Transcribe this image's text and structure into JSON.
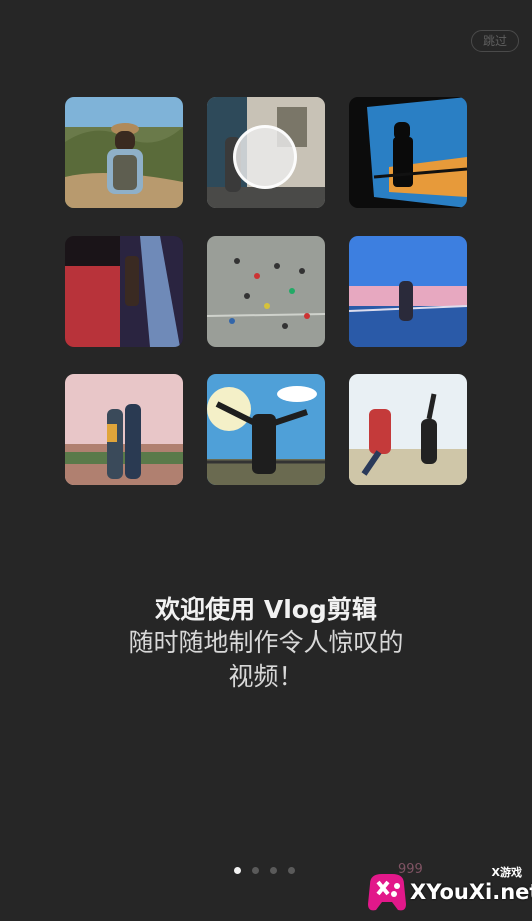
{
  "skip_label": "跳过",
  "welcome": {
    "title": "欢迎使用 Vlog剪辑",
    "subtitle_line1": "随时随地制作令人惊叹的",
    "subtitle_line2": "视频！"
  },
  "pager": {
    "total": 4,
    "active_index": 0
  },
  "watermark": {
    "top_text": "X游戏",
    "main_text": "XYouXi.net",
    "faint_text": "999"
  },
  "colors": {
    "background": "#262626",
    "text_primary": "#f2f2f2",
    "dot_inactive": "#5a5a5a",
    "watermark_brand": "#e2188a"
  }
}
